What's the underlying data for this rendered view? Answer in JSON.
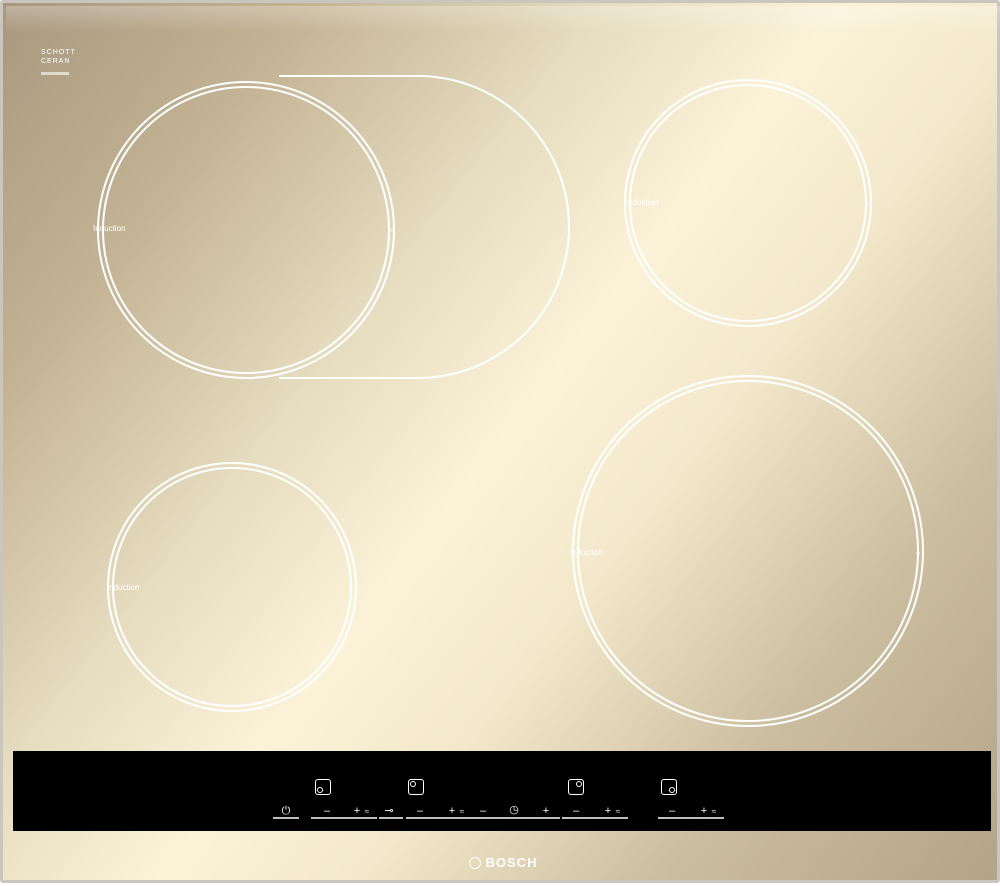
{
  "brand": {
    "schott_line1": "SCHOTT",
    "schott_line2": "CERAN",
    "maker": "BOSCH"
  },
  "zones": [
    {
      "id": "front-left-large",
      "label": "Induction"
    },
    {
      "id": "rear-right",
      "label": "Induction"
    },
    {
      "id": "front-left",
      "label": "Induction"
    },
    {
      "id": "front-right",
      "label": "Induction"
    }
  ],
  "controls": {
    "minus": "–",
    "plus": "+",
    "boost": "≈",
    "power": "⏻",
    "lock": "⊸",
    "timer": "◷"
  },
  "colors": {
    "panel": "#000000",
    "marking": "#ffffff",
    "glass": "#e6dcbf"
  }
}
